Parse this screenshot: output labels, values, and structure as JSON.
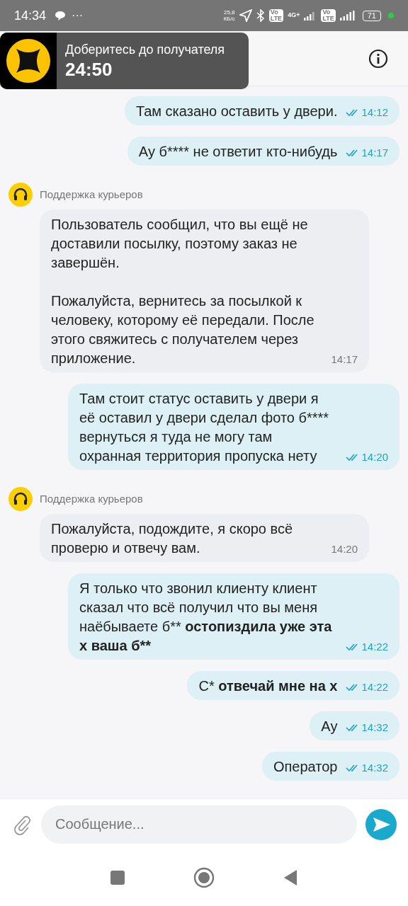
{
  "status_bar": {
    "time": "14:34",
    "more": "···",
    "speed": "25,8\nКБ/с",
    "volte_1": "Vo\nLTE",
    "network": "4G+",
    "volte_2": "Vo\nLTE",
    "battery": "71"
  },
  "notification": {
    "title": "Доберитесь до получателя",
    "timer": "24:50"
  },
  "messages": [
    {
      "kind": "outgoing",
      "parts": [
        {
          "text": "Там сказано оставить у двери.",
          "bold": false
        }
      ],
      "time": "14:12",
      "read": true
    },
    {
      "kind": "outgoing",
      "parts": [
        {
          "text": "Ау б**** не ответит кто-нибудь",
          "bold": false
        }
      ],
      "time": "14:17",
      "read": true
    },
    {
      "kind": "incoming",
      "sender": "Поддержка курьеров",
      "parts": [
        {
          "text": "Пользователь сообщил, что вы ещё не доставили посылку, поэтому заказ не завершён.\n\nПожалуйста, вернитесь за посылкой к человеку, которому её передали. После этого свяжитесь с получателем через приложение.",
          "bold": false
        }
      ],
      "time": "14:17",
      "read": false
    },
    {
      "kind": "outgoing",
      "parts": [
        {
          "text": "Там стоит статус оставить у двери я её оставил у двери сделал фото б**** вернуться я туда не могу там охранная территория пропуска нету",
          "bold": false
        }
      ],
      "time": "14:20",
      "read": true
    },
    {
      "kind": "incoming",
      "sender": "Поддержка курьеров",
      "parts": [
        {
          "text": "Пожалуйста, подождите, я скоро всё проверю и отвечу вам.",
          "bold": false
        }
      ],
      "time": "14:20",
      "read": false
    },
    {
      "kind": "outgoing",
      "parts": [
        {
          "text": "Я только что звонил клиенту клиент сказал что всё получил что вы меня наёбываете б** ",
          "bold": false
        },
        {
          "text": "остопиздила уже эта х ваша б**",
          "bold": true
        }
      ],
      "time": "14:22",
      "read": true
    },
    {
      "kind": "outgoing",
      "parts": [
        {
          "text": "С* ",
          "bold": false
        },
        {
          "text": "отвечай мне на х",
          "bold": true
        }
      ],
      "time": "14:22",
      "read": true
    },
    {
      "kind": "outgoing",
      "parts": [
        {
          "text": "Ау",
          "bold": false
        }
      ],
      "time": "14:32",
      "read": true
    },
    {
      "kind": "outgoing",
      "parts": [
        {
          "text": "Оператор",
          "bold": false
        }
      ],
      "time": "14:32",
      "read": true
    }
  ],
  "composer": {
    "placeholder": "Сообщение..."
  }
}
